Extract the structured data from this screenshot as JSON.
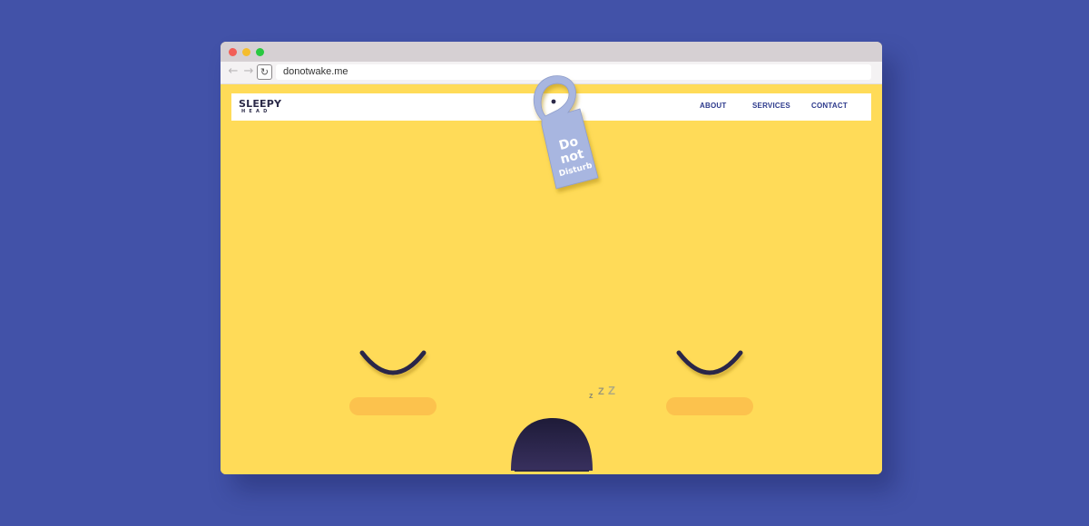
{
  "browser": {
    "url": "donotwake.me",
    "back_icon": "arrow-left-icon",
    "forward_icon": "arrow-right-icon",
    "reload_icon": "reload-icon"
  },
  "site": {
    "logo": {
      "main": "SLEEPY",
      "sub": "HEAD"
    },
    "nav": [
      {
        "label": "ABOUT"
      },
      {
        "label": "SERVICES"
      },
      {
        "label": "CONTACT"
      }
    ],
    "door_hanger": {
      "line1": "Do",
      "line2": "not",
      "line3": "Disturb"
    },
    "zzz": [
      "z",
      "Z",
      "Z"
    ]
  },
  "colors": {
    "background": "#4252a8",
    "page": "#ffdb58",
    "face_features": "#2b2848",
    "blush": "#fcc24d",
    "hanger": "#a8b6e0",
    "nav_text": "#2d3a8c"
  }
}
